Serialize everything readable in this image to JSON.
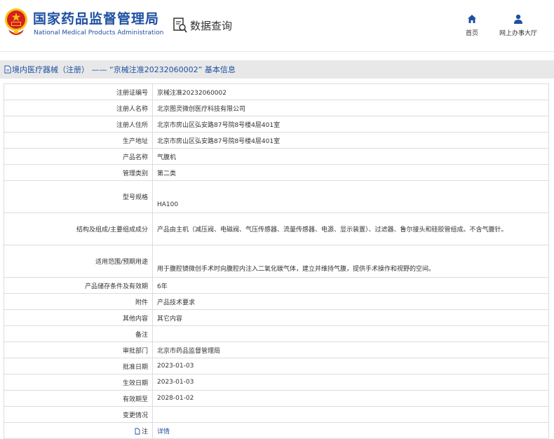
{
  "header": {
    "site_name_cn": "国家药品监督管理局",
    "site_name_en": "National Medical Products Administration",
    "query_label": "数据查询",
    "nav": {
      "home": "首页",
      "office": "网上办事大厅"
    }
  },
  "title_bar": {
    "text": "境内医疗器械（注册） —— “京械注准20232060002” 基本信息"
  },
  "details": [
    {
      "label": "注册证编号",
      "value": "京械注准20232060002"
    },
    {
      "label": "注册人名称",
      "value": "北京图灵微创医疗科技有限公司"
    },
    {
      "label": "注册人住所",
      "value": "北京市房山区弘安路87号院8号楼4层401室"
    },
    {
      "label": "生产地址",
      "value": "北京市房山区弘安路87号院8号楼4层401室"
    },
    {
      "label": "产品名称",
      "value": "气腹机"
    },
    {
      "label": "管理类别",
      "value": "第二类"
    },
    {
      "label": "型号规格",
      "value": "HA100"
    },
    {
      "label": "结构及组成/主要组成成分",
      "value": "产品由主机（减压阀、电磁阀、气压传感器、流量传感器、电源、显示装置）、过滤器、鲁尔接头和硅胶管组成。不含气腹针。"
    },
    {
      "label": "适用范围/预期用途",
      "value": "用于腹腔镜微创手术时向腹腔内注入二氧化碳气体，建立并维持气腹，提供手术操作和视野的空间。"
    },
    {
      "label": "产品储存条件及有效期",
      "value": "6年"
    },
    {
      "label": "附件",
      "value": "产品技术要求"
    },
    {
      "label": "其他内容",
      "value": "其它内容"
    },
    {
      "label": "备注",
      "value": ""
    },
    {
      "label": "审批部门",
      "value": "北京市药品监督管理局"
    },
    {
      "label": "批准日期",
      "value": "2023-01-03"
    },
    {
      "label": "生效日期",
      "value": "2023-01-03"
    },
    {
      "label": "有效期至",
      "value": "2028-01-02"
    },
    {
      "label": "变更情况",
      "value": ""
    },
    {
      "label": "注",
      "value": "详情"
    }
  ],
  "colors": {
    "brand_blue": "#1e50a2",
    "title_bar_bg": "#e8e8e8",
    "emblem_red": "#d71e1e",
    "emblem_gold": "#f3c416"
  }
}
